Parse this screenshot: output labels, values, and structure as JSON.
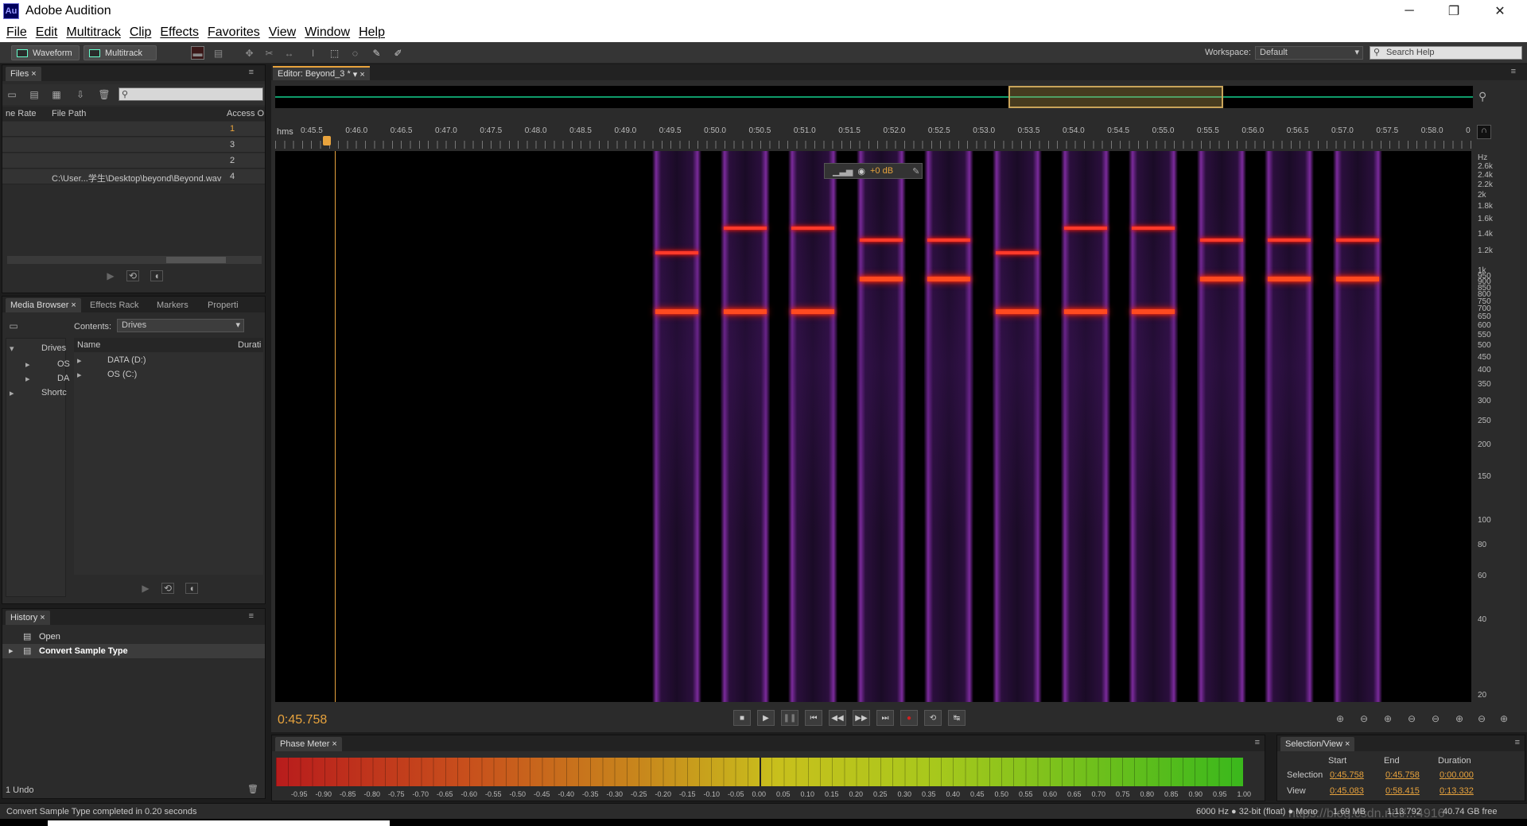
{
  "app": {
    "icon_text": "Au",
    "title": "Adobe Audition"
  },
  "window_controls": {
    "minimize": "─",
    "restore": "❐",
    "close": "✕"
  },
  "menu": [
    "File",
    "Edit",
    "Multitrack",
    "Clip",
    "Effects",
    "Favorites",
    "View",
    "Window",
    "Help"
  ],
  "toolbar": {
    "waveform_label": "Waveform",
    "multitrack_label": "Multitrack",
    "workspace_label": "Workspace:",
    "workspace_value": "Default",
    "search_placeholder": "Search Help"
  },
  "files_panel": {
    "tab": "Files",
    "columns": [
      "ne Rate",
      "File Path",
      "Access O"
    ],
    "rows": [
      {
        "path": "",
        "access": "1"
      },
      {
        "path": "",
        "access": "3"
      },
      {
        "path": "",
        "access": "2"
      },
      {
        "path": "C:\\User...学生\\Desktop\\beyond\\Beyond.wav",
        "access": "4"
      }
    ]
  },
  "media_panel": {
    "tabs": [
      "Media Browser",
      "Effects Rack",
      "Markers",
      "Properti"
    ],
    "contents_label": "Contents:",
    "contents_value": "Drives",
    "tree": [
      "Drives",
      "OS",
      "DA",
      "Shortc"
    ],
    "columns": [
      "Name",
      "Durati"
    ],
    "items": [
      "DATA (D:)",
      "OS (C:)"
    ]
  },
  "history_panel": {
    "tab": "History",
    "items": [
      "Open",
      "Convert Sample Type"
    ],
    "undo_count": "1 Undo"
  },
  "editor": {
    "tab": "Editor: Beyond_3 *",
    "time_unit": "hms",
    "ticks": [
      "0:45.5",
      "0:46.0",
      "0:46.5",
      "0:47.0",
      "0:47.5",
      "0:48.0",
      "0:48.5",
      "0:49.0",
      "0:49.5",
      "0:50.0",
      "0:50.5",
      "0:51.0",
      "0:51.5",
      "0:52.0",
      "0:52.5",
      "0:53.0",
      "0:53.5",
      "0:54.0",
      "0:54.5",
      "0:55.0",
      "0:55.5",
      "0:56.0",
      "0:56.5",
      "0:57.0",
      "0:57.5",
      "0:58.0",
      "0"
    ],
    "hud_gain": "+0 dB",
    "current_time": "0:45.758",
    "hz_unit": "Hz",
    "hz_labels": [
      "2.6k",
      "2.4k",
      "2.2k",
      "2k",
      "1.8k",
      "1.6k",
      "1.4k",
      "1.2k",
      "1k",
      "950",
      "900",
      "850",
      "800",
      "750",
      "700",
      "650",
      "600",
      "550",
      "500",
      "450",
      "400",
      "350",
      "300",
      "250",
      "200",
      "150",
      "100",
      "80",
      "60",
      "40",
      "20"
    ]
  },
  "spectrogram": {
    "type": "spectral_frequency",
    "tones": [
      {
        "hi": 1200,
        "lo": 700
      },
      {
        "hi": 1500,
        "lo": 700
      },
      {
        "hi": 1500,
        "lo": 700
      },
      {
        "hi": 1350,
        "lo": 950
      },
      {
        "hi": 1350,
        "lo": 950
      },
      {
        "hi": 1200,
        "lo": 700
      },
      {
        "hi": 1500,
        "lo": 700
      },
      {
        "hi": 1500,
        "lo": 700
      },
      {
        "hi": 1350,
        "lo": 950
      },
      {
        "hi": 1350,
        "lo": 950
      },
      {
        "hi": 1350,
        "lo": 950
      }
    ]
  },
  "transport": {
    "stop": "■",
    "play": "▶",
    "pause": "❚❚",
    "to_start": "⏮",
    "rewind": "◀◀",
    "forward": "▶▶",
    "to_end": "⏭",
    "record": "●",
    "loop": "⟲",
    "skip": "↹"
  },
  "phase_meter": {
    "tab": "Phase Meter",
    "labels": [
      "-0.95",
      "-0.90",
      "-0.85",
      "-0.80",
      "-0.75",
      "-0.70",
      "-0.65",
      "-0.60",
      "-0.55",
      "-0.50",
      "-0.45",
      "-0.40",
      "-0.35",
      "-0.30",
      "-0.25",
      "-0.20",
      "-0.15",
      "-0.10",
      "-0.05",
      "0.00",
      "0.05",
      "0.10",
      "0.15",
      "0.20",
      "0.25",
      "0.30",
      "0.35",
      "0.40",
      "0.45",
      "0.50",
      "0.55",
      "0.60",
      "0.65",
      "0.70",
      "0.75",
      "0.80",
      "0.85",
      "0.90",
      "0.95",
      "1.00"
    ]
  },
  "selection_view": {
    "tab": "Selection/View",
    "headers": [
      "Start",
      "End",
      "Duration"
    ],
    "selection": {
      "label": "Selection",
      "start": "0:45.758",
      "end": "0:45.758",
      "duration": "0:00.000"
    },
    "view": {
      "label": "View",
      "start": "0:45.083",
      "end": "0:58.415",
      "duration": "0:13.332"
    }
  },
  "status": {
    "message": "Convert Sample Type completed in 0.20 seconds",
    "format": "6000 Hz ● 32-bit (float) ● Mono",
    "size": "1.69 MB",
    "duration": "1:13.792",
    "free": "40.74 GB free",
    "watermark": "https://blog.csdn.net/...4916"
  },
  "colors": {
    "accent": "#e8a33d",
    "tone": "#ff3a2a",
    "bg": "#2b2b2b"
  }
}
